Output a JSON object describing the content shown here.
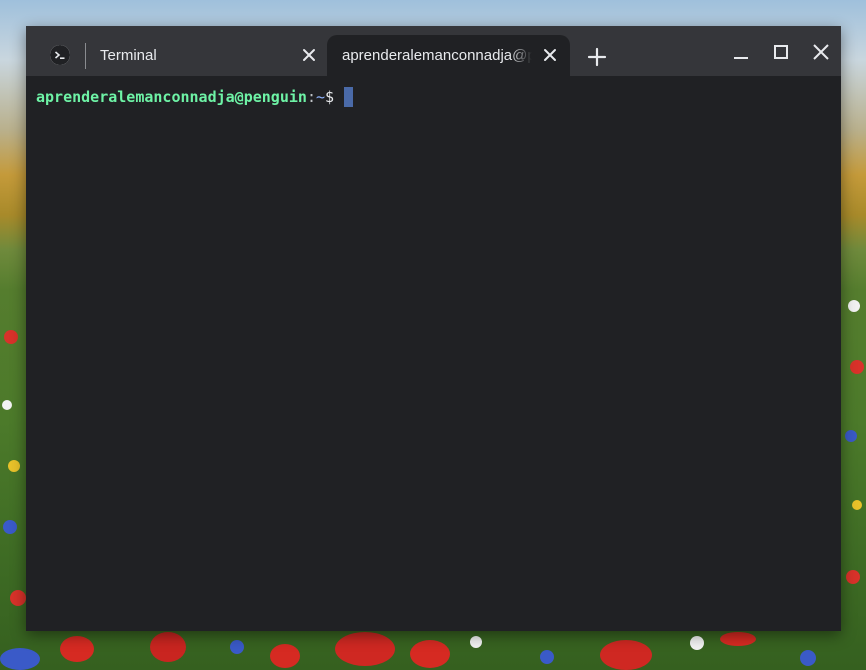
{
  "window": {
    "tabs": [
      {
        "label": "Terminal",
        "active": false,
        "icon": "terminal-icon"
      },
      {
        "label": "aprenderalemanconnadja@penguin: ~",
        "active": true
      }
    ],
    "controls": [
      "minimize-icon",
      "maximize-icon",
      "close-icon"
    ],
    "new_tab_icon": "plus-icon"
  },
  "terminal": {
    "user_host": "aprenderalemanconnadja@penguin",
    "separator": ":",
    "path": "~",
    "prompt_symbol": "$",
    "background": "#202124",
    "user_color": "#6ef3a6",
    "cursor_color": "#4a6aa8"
  },
  "colors": {
    "titlebar": "#35363a",
    "active_tab": "#202124",
    "text": "#e8eaed"
  }
}
